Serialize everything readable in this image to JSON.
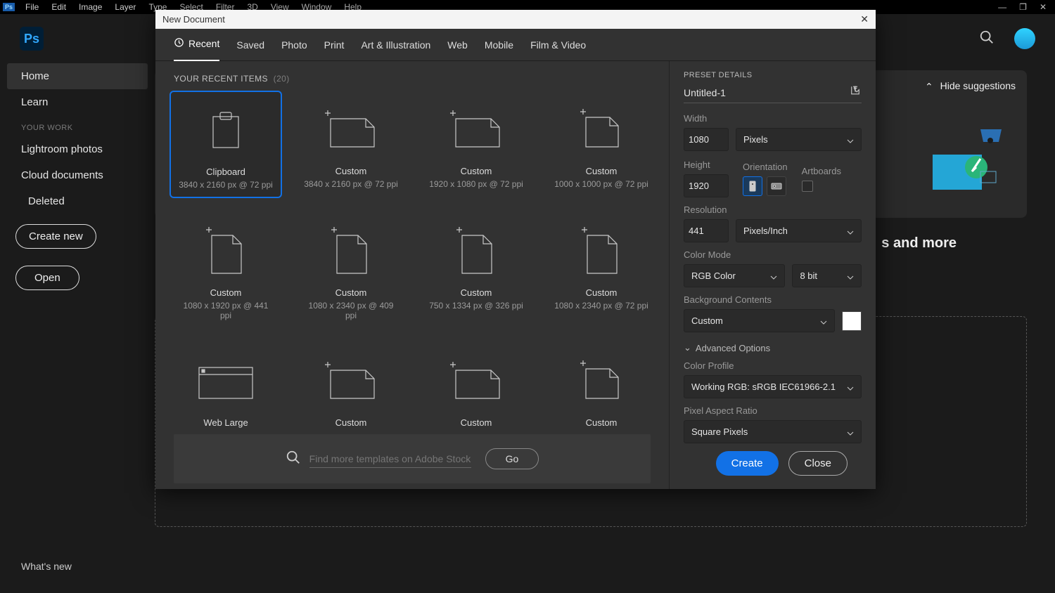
{
  "menubar": {
    "items": [
      "File",
      "Edit",
      "Image",
      "Layer",
      "Type",
      "Select",
      "Filter",
      "3D",
      "View",
      "Window",
      "Help"
    ]
  },
  "sidebar": {
    "home": "Home",
    "learn": "Learn",
    "your_work": "YOUR WORK",
    "lightroom": "Lightroom photos",
    "cloud": "Cloud documents",
    "deleted": "Deleted",
    "create": "Create new",
    "open": "Open",
    "whatsnew": "What's new"
  },
  "home": {
    "hide_sugg": "Hide suggestions",
    "more": "s and more"
  },
  "dialog": {
    "title": "New Document",
    "tabs": [
      "Recent",
      "Saved",
      "Photo",
      "Print",
      "Art & Illustration",
      "Web",
      "Mobile",
      "Film & Video"
    ],
    "gal_head": "YOUR RECENT ITEMS",
    "gal_count": "(20)",
    "search_placeholder": "Find more templates on Adobe Stock",
    "go": "Go",
    "cards": [
      {
        "title": "Clipboard",
        "meta": "3840 x 2160 px @ 72 ppi",
        "icon": "clipboard",
        "selected": true
      },
      {
        "title": "Custom",
        "meta": "3840 x 2160 px @ 72 ppi",
        "icon": "doc-land"
      },
      {
        "title": "Custom",
        "meta": "1920 x 1080 px @ 72 ppi",
        "icon": "doc-land"
      },
      {
        "title": "Custom",
        "meta": "1000 x 1000 px @ 72 ppi",
        "icon": "doc-sq"
      },
      {
        "title": "Custom",
        "meta": "1080 x 1920 px @ 441 ppi",
        "icon": "doc-port"
      },
      {
        "title": "Custom",
        "meta": "1080 x 2340 px @ 409 ppi",
        "icon": "doc-port"
      },
      {
        "title": "Custom",
        "meta": "750 x 1334 px @ 326 ppi",
        "icon": "doc-port"
      },
      {
        "title": "Custom",
        "meta": "1080 x 2340 px @ 72 ppi",
        "icon": "doc-port"
      },
      {
        "title": "Web Large",
        "meta": "",
        "icon": "browser"
      },
      {
        "title": "Custom",
        "meta": "",
        "icon": "doc-land"
      },
      {
        "title": "Custom",
        "meta": "",
        "icon": "doc-land"
      },
      {
        "title": "Custom",
        "meta": "",
        "icon": "doc-sq"
      }
    ]
  },
  "details": {
    "head": "PRESET DETAILS",
    "name": "Untitled-1",
    "width_label": "Width",
    "width": "1080",
    "width_unit": "Pixels",
    "height_label": "Height",
    "height": "1920",
    "orient_label": "Orientation",
    "artboards_label": "Artboards",
    "res_label": "Resolution",
    "res": "441",
    "res_unit": "Pixels/Inch",
    "colormode_label": "Color Mode",
    "colormode": "RGB Color",
    "bitdepth": "8 bit",
    "bg_label": "Background Contents",
    "bg": "Custom",
    "adv": "Advanced Options",
    "profile_label": "Color Profile",
    "profile": "Working RGB: sRGB IEC61966-2.1",
    "par_label": "Pixel Aspect Ratio",
    "par": "Square Pixels",
    "create": "Create",
    "close": "Close"
  }
}
